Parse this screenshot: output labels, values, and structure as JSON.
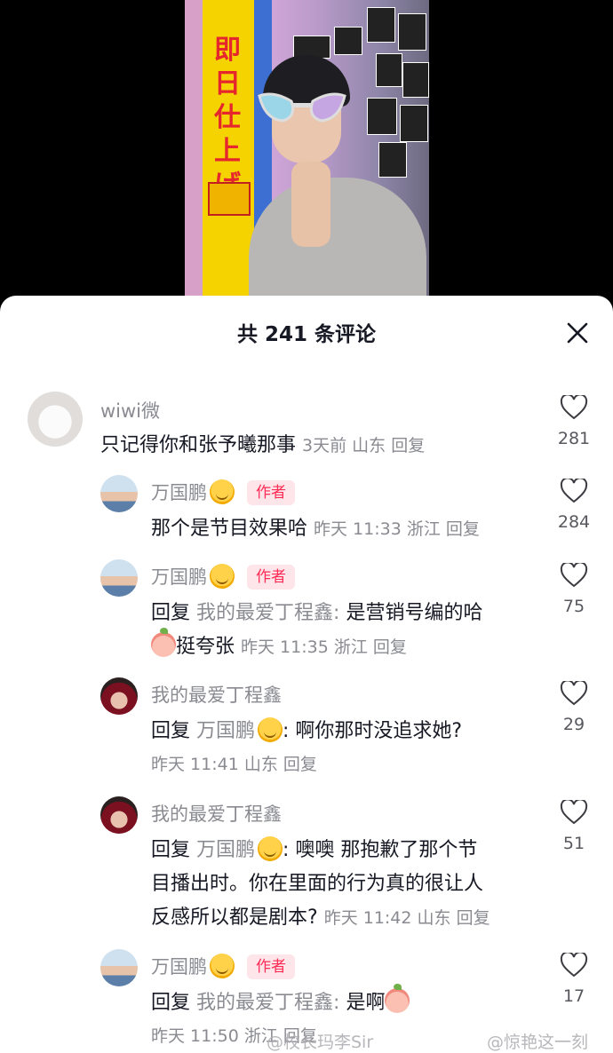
{
  "sheet": {
    "title": "共 241 条评论"
  },
  "comments": [
    {
      "user": "wiwi微",
      "body": "只记得你和张予曦那事",
      "meta_time": "3天前",
      "meta_loc": "山东",
      "reply_label": "回复",
      "likes": "281"
    },
    {
      "user": "万国鹏",
      "tag": "作者",
      "body": "那个是节目效果哈",
      "meta_time": "昨天 11:33",
      "meta_loc": "浙江",
      "reply_label": "回复",
      "likes": "284"
    },
    {
      "user": "万国鹏",
      "tag": "作者",
      "reply_prefix": "回复",
      "reply_target": "我的最爱丁程鑫:",
      "body": "是营销号编的哈",
      "body2": "挺夸张",
      "meta_time": "昨天 11:35",
      "meta_loc": "浙江",
      "reply_label": "回复",
      "likes": "75"
    },
    {
      "user": "我的最爱丁程鑫",
      "reply_prefix": "回复",
      "reply_target": "万国鹏",
      "body": ": 啊你那时没追求她?",
      "meta_time": "昨天 11:41",
      "meta_loc": "山东",
      "reply_label": "回复",
      "likes": "29"
    },
    {
      "user": "我的最爱丁程鑫",
      "reply_prefix": "回复",
      "reply_target": "万国鹏",
      "body": ": 噢噢 那抱歉了那个节",
      "body2": "目播出时。你在里面的行为真的很让人",
      "body3": "反感所以都是剧本?",
      "meta_time": "昨天 11:42",
      "meta_loc": "山东",
      "reply_label": "回复",
      "likes": "51"
    },
    {
      "user": "万国鹏",
      "tag": "作者",
      "reply_prefix": "回复",
      "reply_target": "我的最爱丁程鑫:",
      "body": "是啊",
      "meta_time": "昨天 11:50",
      "meta_loc": "浙江",
      "reply_label": "回复",
      "likes": "17"
    }
  ],
  "watermarks": {
    "left": "@校长玛李Sir",
    "right": "@惊艳这一刻"
  },
  "video_text": {
    "banner": "即日仕上げ"
  },
  "colors": {
    "accent_tag": "#fe2c55",
    "tag_bg": "#fde5ea",
    "secondary_text": "#8a8b91"
  }
}
